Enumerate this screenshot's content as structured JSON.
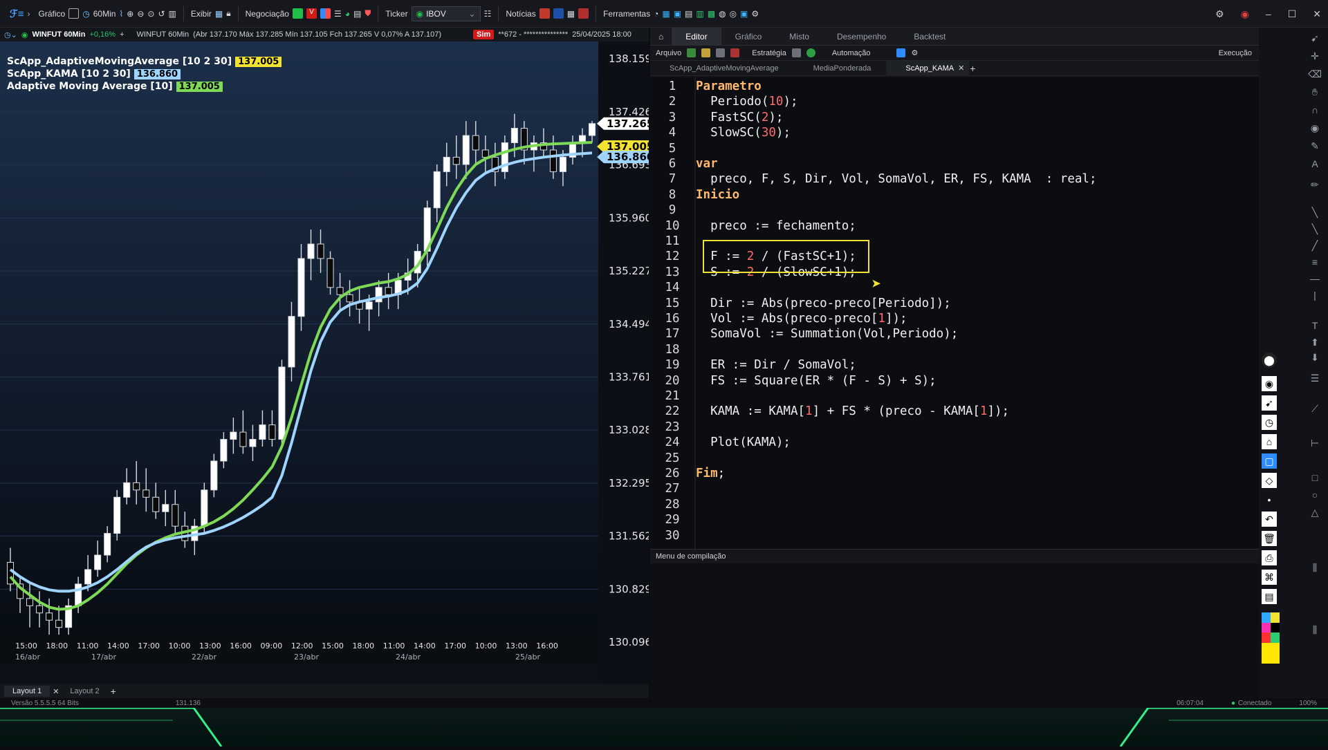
{
  "topbar": {
    "menus": [
      "Gráfico",
      "Exibir",
      "Negociação",
      "Ticker",
      "Notícias",
      "Ferramentas"
    ],
    "timeframe": "60Min",
    "ticker_value": "IBOV"
  },
  "chart": {
    "symbol": "WINFUT 60Min",
    "symbol_change": "+0,16%",
    "ohlc": "(Abr 137.170 Máx 137.285 Mín 137.105 Fch 137.265 V 0,07% A 137.107)",
    "sim_label": "Sim",
    "account": "**672 - ***************",
    "datetime": "25/04/2025 18:00",
    "indicators": [
      {
        "name": "ScApp_AdaptiveMovingAverage [10 2 30]",
        "value": "137.005",
        "color": "#f2e233"
      },
      {
        "name": "ScApp_KAMA [10 2 30]",
        "value": "136.860",
        "color": "#9fd4ff"
      },
      {
        "name": "Adaptive Moving Average [10]",
        "value": "137.005",
        "color": "#7ed957"
      }
    ],
    "price_labels": [
      {
        "value": "137.265",
        "bg": "#ffffff",
        "fg": "#000000"
      },
      {
        "value": "137.005",
        "bg": "#f2e233",
        "fg": "#000000"
      },
      {
        "value": "136.860",
        "bg": "#9fd4ff",
        "fg": "#000000"
      }
    ],
    "y_ticks": [
      "138.159",
      "137.426",
      "136.693",
      "135.960",
      "135.227",
      "134.494",
      "133.761",
      "133.028",
      "132.295",
      "131.562",
      "130.829",
      "130.096"
    ],
    "x_time_ticks": [
      "15:00",
      "18:00",
      "11:00",
      "14:00",
      "17:00",
      "10:00",
      "13:00",
      "16:00",
      "09:00",
      "12:00",
      "15:00",
      "18:00",
      "11:00",
      "14:00",
      "17:00",
      "10:00",
      "13:00",
      "16:00"
    ],
    "x_date_ticks": [
      "16/abr",
      "17/abr",
      "22/abr",
      "23/abr",
      "24/abr",
      "25/abr"
    ],
    "layouts": [
      "Layout 1",
      "Layout 2"
    ]
  },
  "chart_data": {
    "type": "line",
    "title": "WINFUT 60Min",
    "xlabel": "",
    "ylabel": "",
    "ylim": [
      129800,
      138400
    ],
    "candles": [
      [
        131200,
        131400,
        130800,
        130900
      ],
      [
        130900,
        131000,
        130500,
        130700
      ],
      [
        130700,
        130900,
        130300,
        130600
      ],
      [
        130600,
        130800,
        130300,
        130500
      ],
      [
        130500,
        130700,
        130200,
        130400
      ],
      [
        130400,
        130600,
        130200,
        130300
      ],
      [
        130300,
        130700,
        130200,
        130600
      ],
      [
        130600,
        131000,
        130500,
        130900
      ],
      [
        130900,
        131300,
        130800,
        131100
      ],
      [
        131100,
        131500,
        131000,
        131300
      ],
      [
        131300,
        131700,
        131200,
        131600
      ],
      [
        131600,
        132200,
        131500,
        132100
      ],
      [
        132100,
        132500,
        132000,
        132300
      ],
      [
        132300,
        132600,
        132000,
        132200
      ],
      [
        132200,
        132500,
        131900,
        132100
      ],
      [
        132100,
        132300,
        131800,
        131900
      ],
      [
        131900,
        132200,
        131700,
        132000
      ],
      [
        132000,
        132200,
        131600,
        131700
      ],
      [
        131700,
        131900,
        131400,
        131500
      ],
      [
        131500,
        131800,
        131300,
        131700
      ],
      [
        131700,
        132300,
        131600,
        132200
      ],
      [
        132200,
        132700,
        132100,
        132600
      ],
      [
        132600,
        133000,
        132500,
        132900
      ],
      [
        132900,
        133200,
        132700,
        133000
      ],
      [
        133000,
        133300,
        132700,
        132800
      ],
      [
        132800,
        133100,
        132600,
        132900
      ],
      [
        132900,
        133300,
        132800,
        133100
      ],
      [
        133100,
        133300,
        132800,
        132900
      ],
      [
        132900,
        134000,
        132800,
        133900
      ],
      [
        133900,
        134800,
        133700,
        134600
      ],
      [
        134600,
        135600,
        134400,
        135400
      ],
      [
        135400,
        135800,
        135100,
        135600
      ],
      [
        135600,
        135800,
        135200,
        135400
      ],
      [
        135400,
        135500,
        134900,
        135000
      ],
      [
        135000,
        135200,
        134700,
        134900
      ],
      [
        134900,
        135100,
        134600,
        134800
      ],
      [
        134800,
        135000,
        134500,
        134700
      ],
      [
        134700,
        134900,
        134400,
        134800
      ],
      [
        134800,
        135100,
        134600,
        135000
      ],
      [
        135000,
        135200,
        134700,
        134900
      ],
      [
        134900,
        135200,
        134700,
        135100
      ],
      [
        135100,
        135400,
        134900,
        135200
      ],
      [
        135200,
        135600,
        135000,
        135500
      ],
      [
        135500,
        136200,
        135300,
        136100
      ],
      [
        136100,
        136700,
        135900,
        136600
      ],
      [
        136600,
        137000,
        136400,
        136800
      ],
      [
        136800,
        137100,
        136500,
        136700
      ],
      [
        136700,
        137300,
        136500,
        137100
      ],
      [
        137100,
        137300,
        136700,
        136900
      ],
      [
        136900,
        137100,
        136600,
        136800
      ],
      [
        136800,
        137000,
        136400,
        136600
      ],
      [
        136600,
        137100,
        136500,
        137000
      ],
      [
        137000,
        137400,
        136800,
        137200
      ],
      [
        137200,
        137300,
        136700,
        136900
      ],
      [
        136900,
        137100,
        136600,
        137000
      ],
      [
        137000,
        137200,
        136800,
        136900
      ],
      [
        136900,
        137100,
        136500,
        136600
      ],
      [
        136600,
        136900,
        136400,
        136800
      ],
      [
        136800,
        137100,
        136700,
        137000
      ],
      [
        137000,
        137200,
        136800,
        137100
      ],
      [
        137100,
        137300,
        137000,
        137265
      ]
    ],
    "series": [
      {
        "name": "ScApp_AdaptiveMovingAverage [10 2 30]",
        "color": "#7ed957",
        "values": [
          131000,
          130850,
          130750,
          130650,
          130580,
          130550,
          130560,
          130600,
          130680,
          130780,
          130900,
          131040,
          131180,
          131300,
          131400,
          131480,
          131540,
          131590,
          131620,
          131650,
          131700,
          131760,
          131840,
          131940,
          132060,
          132200,
          132350,
          132520,
          132800,
          133200,
          133650,
          134100,
          134450,
          134700,
          134860,
          134950,
          135000,
          135030,
          135060,
          135080,
          135120,
          135180,
          135300,
          135520,
          135800,
          136100,
          136350,
          136550,
          136700,
          136780,
          136830,
          136870,
          136910,
          136940,
          136960,
          136975,
          136985,
          136990,
          136995,
          137000,
          137005
        ]
      },
      {
        "name": "ScApp_KAMA [10 2 30]",
        "color": "#9fd4ff",
        "values": [
          131100,
          131000,
          130920,
          130860,
          130820,
          130800,
          130800,
          130820,
          130860,
          130920,
          131000,
          131100,
          131210,
          131320,
          131410,
          131470,
          131510,
          131540,
          131560,
          131580,
          131600,
          131640,
          131690,
          131750,
          131820,
          131900,
          131990,
          132100,
          132400,
          132850,
          133350,
          133850,
          134250,
          134520,
          134680,
          134760,
          134800,
          134830,
          134860,
          134880,
          134910,
          134960,
          135060,
          135260,
          135540,
          135840,
          136100,
          136310,
          136480,
          136580,
          136640,
          136690,
          136730,
          136760,
          136780,
          136800,
          136815,
          136830,
          136840,
          136850,
          136860
        ]
      }
    ]
  },
  "editor": {
    "tabs": [
      "Editor",
      "Gráfico",
      "Misto",
      "Desempenho",
      "Backtest"
    ],
    "active_tab": "Editor",
    "toolbar": [
      "Arquivo",
      "Estratégia",
      "Automação",
      "Execução"
    ],
    "files": [
      "ScApp_AdaptiveMovingAverage",
      "MediaPonderada",
      "ScApp_KAMA"
    ],
    "active_file": "ScApp_KAMA",
    "code_lines": [
      "Parametro",
      "  Periodo(10);",
      "  FastSC(2);",
      "  SlowSC(30);",
      "",
      "var",
      "  preco, F, S, Dir, Vol, SomaVol, ER, FS, KAMA  : real;",
      "Inicio",
      "",
      "  preco := fechamento;",
      "",
      "  F := 2 / (FastSC+1);",
      "  S := 2 / (SlowSC+1);",
      "",
      "  Dir := Abs(preco-preco[Periodo]);",
      "  Vol := Abs(preco-preco[1]);",
      "  SomaVol := Summation(Vol,Periodo);",
      "",
      "  ER := Dir / SomaVol;",
      "  FS := Square(ER * (F - S) + S);",
      "",
      "  KAMA := KAMA[1] + FS * (preco - KAMA[1]);",
      "",
      "  Plot(KAMA);",
      "",
      "Fim;",
      "",
      "",
      "",
      ""
    ],
    "compile_title": "Menu de compilação"
  },
  "status": {
    "version": "Versão 5.5.5.5 64 Bits",
    "cursor_value": "131.136",
    "clock": "06:07:04",
    "connection": "Conectado",
    "zoom": "100%"
  }
}
